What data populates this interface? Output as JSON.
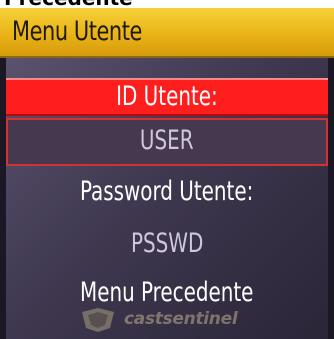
{
  "top_strip": {
    "text": "Precedente"
  },
  "header": {
    "title": "Menu Utente"
  },
  "menu": {
    "id_label": "ID Utente:",
    "id_value": "USER",
    "password_label": "Password Utente:",
    "password_value": "PSSWD",
    "back_label": "Menu Precedente"
  },
  "watermark": {
    "text": "castsentinel"
  },
  "colors": {
    "header_accent": "#e9b417",
    "selected_row": "#ff1e1e",
    "background": "#3f3850",
    "text": "#ffffff"
  }
}
